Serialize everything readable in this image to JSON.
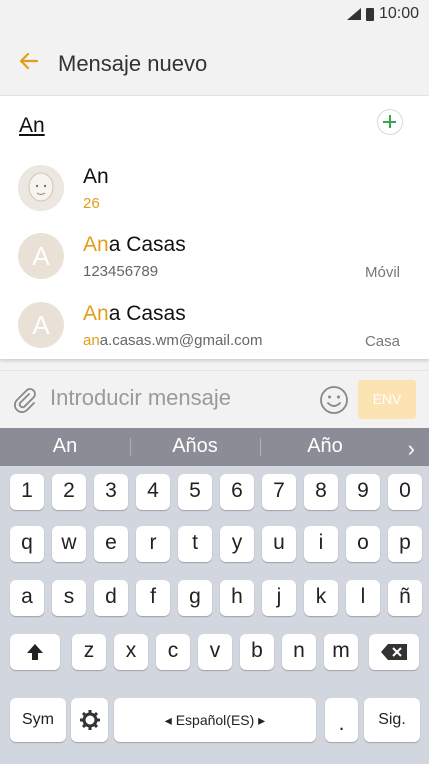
{
  "status": {
    "time": "10:00"
  },
  "header": {
    "title": "Mensaje nuevo"
  },
  "recipient": {
    "value": "An"
  },
  "suggestions": [
    {
      "name_hl": "",
      "name_rest": "An",
      "detail_hl": "",
      "detail_rest": "26",
      "type": ""
    },
    {
      "name_hl": "An",
      "name_rest": "a Casas",
      "detail_hl": "",
      "detail_rest": "123456789",
      "type": "Móvil"
    },
    {
      "name_hl": "An",
      "name_rest": "a Casas",
      "detail_hl": "an",
      "detail_rest": "a.casas.wm@gmail.com",
      "type": "Casa"
    }
  ],
  "avatar_letters": {
    "ana": "A"
  },
  "composer": {
    "placeholder": "Introducir mensaje",
    "send_label": "ENV"
  },
  "predictions": [
    "An",
    "Años",
    "Año"
  ],
  "keyboard": {
    "row_numbers": [
      "1",
      "2",
      "3",
      "4",
      "5",
      "6",
      "7",
      "8",
      "9",
      "0"
    ],
    "row1": [
      "q",
      "w",
      "e",
      "r",
      "t",
      "y",
      "u",
      "i",
      "o",
      "p"
    ],
    "row2": [
      "a",
      "s",
      "d",
      "f",
      "g",
      "h",
      "j",
      "k",
      "l",
      "ñ"
    ],
    "row3": [
      "z",
      "x",
      "c",
      "v",
      "b",
      "n",
      "m"
    ],
    "sym": "Sym",
    "space": "◂ Español(ES) ▸",
    "period": ".",
    "next": "Sig."
  },
  "colors": {
    "accent": "#e39d1a",
    "plus": "#3aa54a",
    "send_bg": "#fbe3b3"
  }
}
